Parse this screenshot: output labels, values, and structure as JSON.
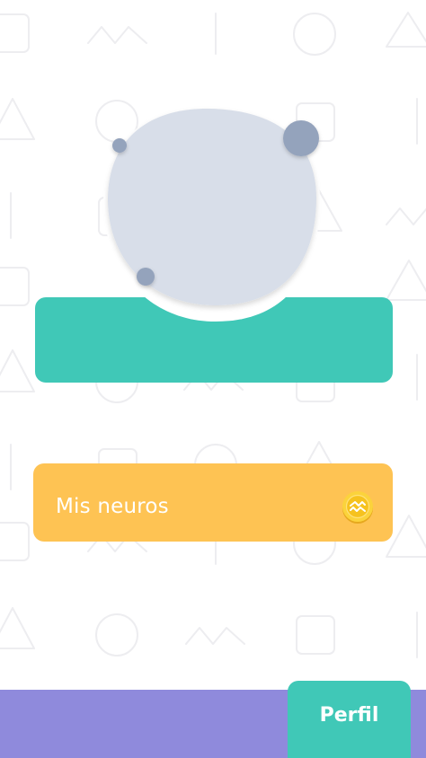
{
  "colors": {
    "teal": "#40c8b7",
    "yellow": "#fec353",
    "purple": "#8f8adc",
    "avatar_blob": "#d8dee9",
    "avatar_dots": "#94a3bc"
  },
  "profile": {
    "avatar_icon": "avatar-blob"
  },
  "neuros": {
    "label": "Mis neuros",
    "icon": "coin-icon"
  },
  "nav": {
    "active_tab_label": "Perfil"
  }
}
